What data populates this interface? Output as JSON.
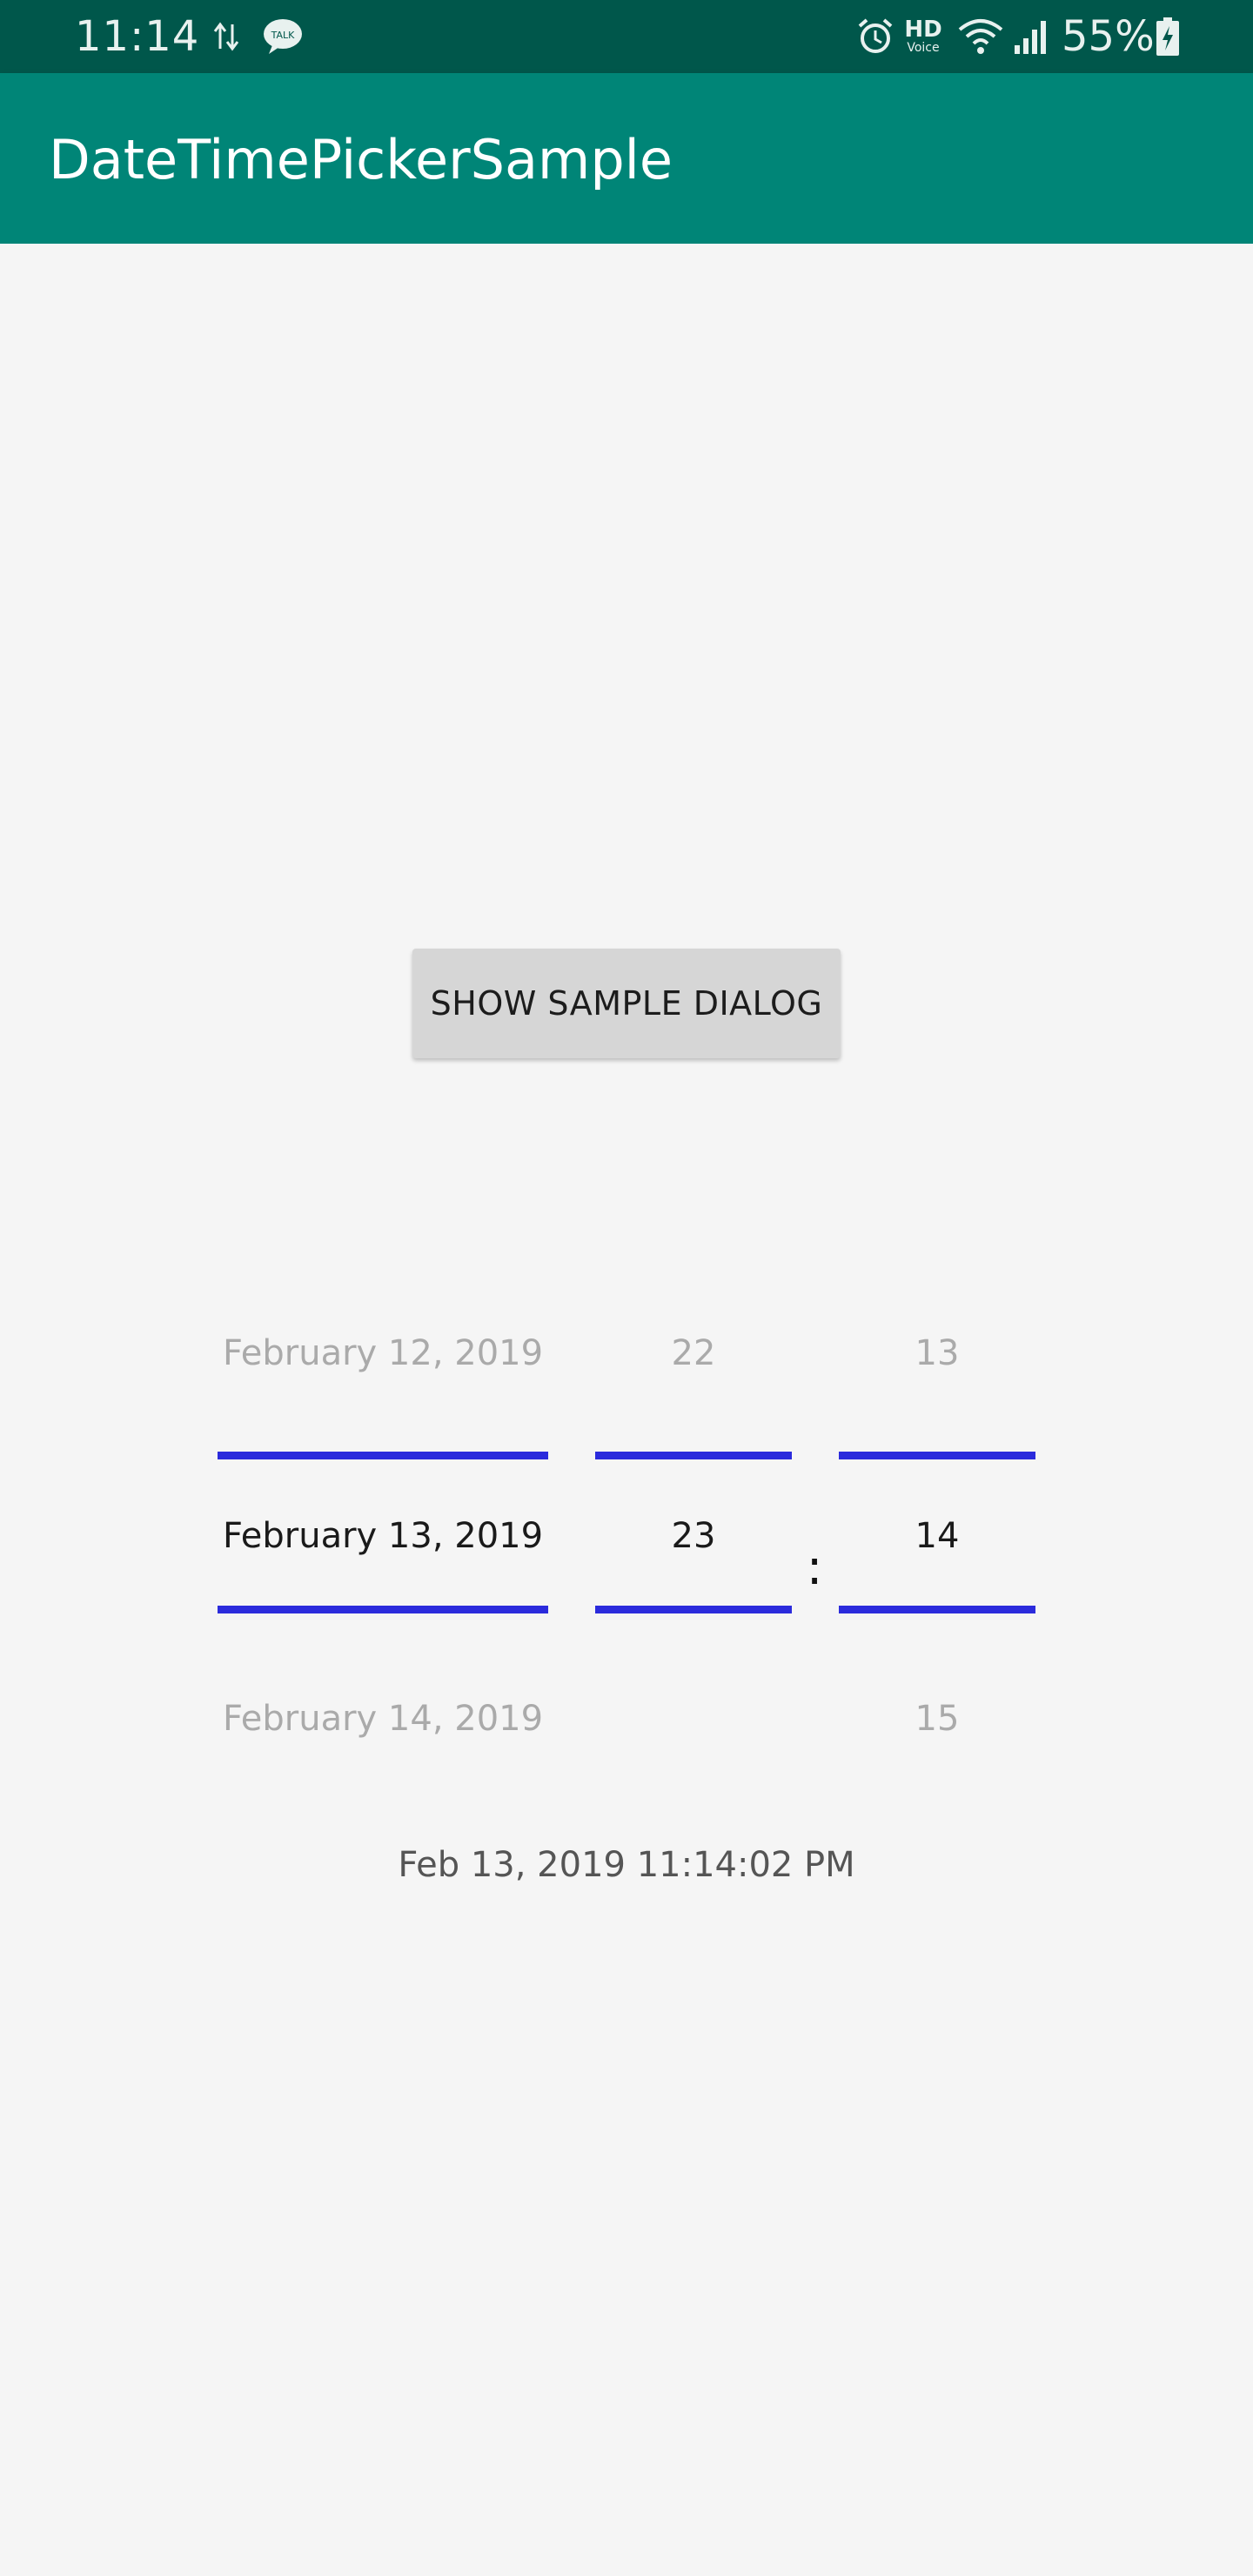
{
  "status_bar": {
    "time": "11:14",
    "battery_percent": "55%",
    "icons": [
      "data-transfer-icon",
      "talk-message-icon",
      "alarm-icon",
      "hd-voice-icon",
      "wifi-icon",
      "signal-icon",
      "battery-charging-icon"
    ],
    "hd_label": "HD",
    "voice_label": "Voice",
    "talk_label": "TALK"
  },
  "app_bar": {
    "title": "DateTimePickerSample"
  },
  "main": {
    "button_label": "SHOW SAMPLE DIALOG"
  },
  "picker": {
    "date_column": [
      "February 12, 2019",
      "February 13, 2019",
      "February 14, 2019"
    ],
    "hour_column": [
      "22",
      "23",
      ""
    ],
    "minute_column": [
      "13",
      "14",
      "15"
    ],
    "separator": ":",
    "selected_index": 1,
    "divider_color": "#2b2bdc"
  },
  "result_text": "Feb 13, 2019 11:14:02 PM",
  "colors": {
    "status_bar": "#00574b",
    "app_bar": "#008577",
    "background": "#f5f5f5",
    "button": "#d6d6d6"
  }
}
